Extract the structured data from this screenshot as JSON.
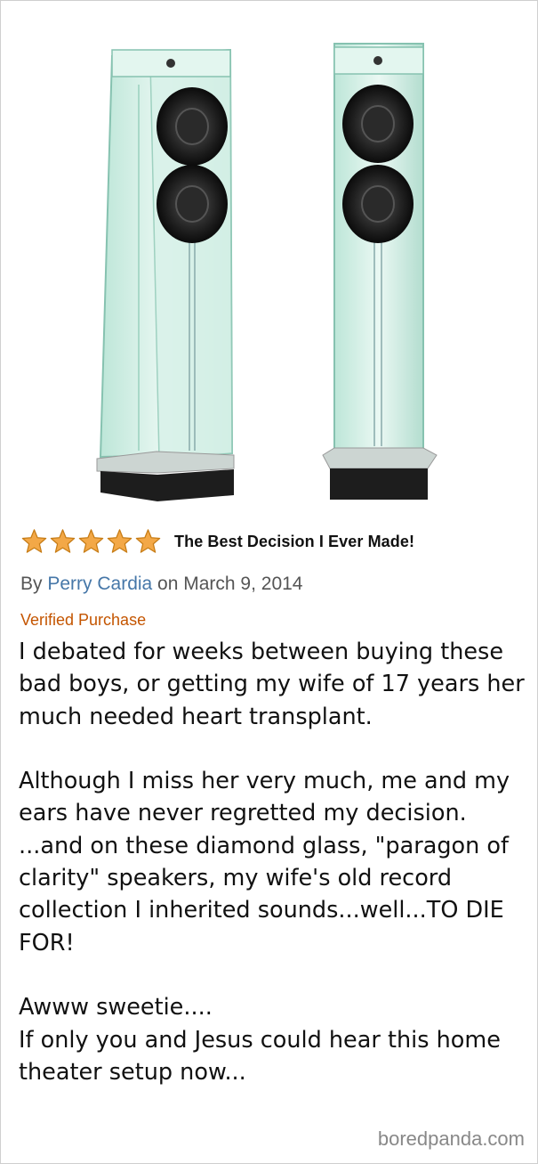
{
  "review": {
    "rating": 5,
    "max_rating": 5,
    "title": "The Best Decision I Ever Made!",
    "by_prefix": "By ",
    "author": "Perry Cardia",
    "date_text": " on March 9, 2014",
    "verified": "Verified Purchase",
    "paragraphs": [
      "I debated for weeks between buying these bad boys, or getting my wife of 17 years her much needed heart transplant.",
      "",
      "Although I miss her very much, me and my ears have never regretted my decision.",
      "...and on these diamond glass, \"paragon of clarity\" speakers, my wife's old record collection I inherited sounds...well...TO DIE FOR!",
      "",
      "Awww sweetie....",
      "If only you and Jesus could hear this home theater setup now..."
    ]
  },
  "watermark": "boredpanda.com",
  "colors": {
    "star": "#f3a847",
    "star_outline": "#c77c15",
    "author_link": "#4677a8",
    "verified": "#c45500",
    "glass": "#cfeee4"
  },
  "product_image": {
    "description_icon": "glass-tower-speakers-image"
  }
}
